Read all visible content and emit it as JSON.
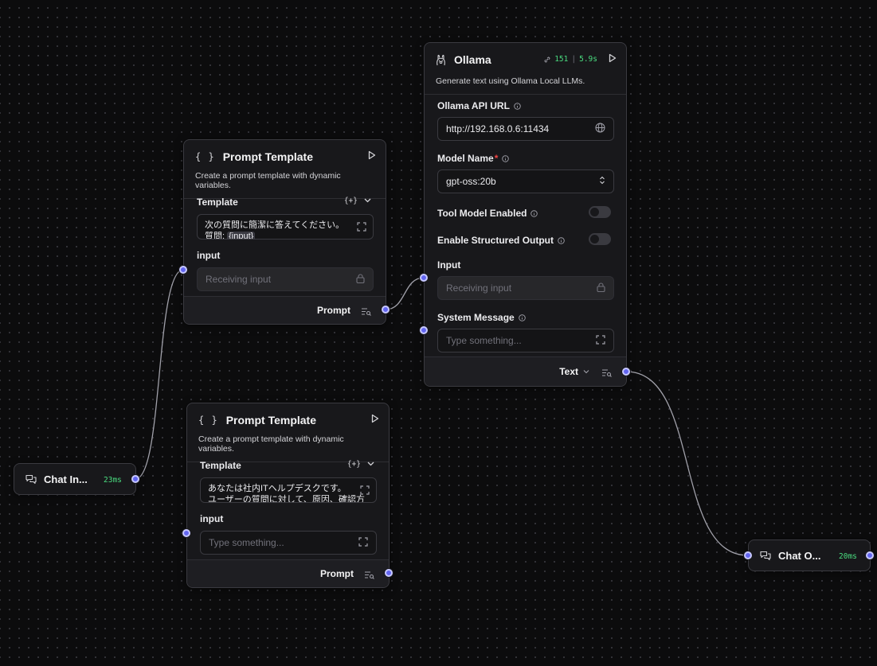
{
  "nodes": {
    "prompt1": {
      "title": "Prompt Template",
      "description": "Create a prompt template with dynamic variables.",
      "template_label": "Template",
      "template_actions": "{+}",
      "template_line1": "次の質問に簡潔に答えてください。",
      "template_line2_prefix": "質問: ",
      "template_line2_var": "{input}",
      "input_label": "input",
      "input_placeholder": "Receiving input",
      "output_label": "Prompt"
    },
    "prompt2": {
      "title": "Prompt Template",
      "description": "Create a prompt template with dynamic variables.",
      "template_label": "Template",
      "template_actions": "{+}",
      "template_line1": "あなたは社内ITヘルプデスクです。",
      "template_line2": "ユーザーの質問に対して、原因、確認方",
      "input_label": "input",
      "input_placeholder": "Type something...",
      "output_label": "Prompt"
    },
    "ollama": {
      "title": "Ollama",
      "tokens": "151",
      "latency": "5.9s",
      "description": "Generate text using Ollama Local LLMs.",
      "api_url_label": "Ollama API URL",
      "api_url_value": "http://192.168.0.6:11434",
      "model_name_label": "Model Name",
      "model_name_required": "*",
      "model_name_value": "gpt-oss:20b",
      "tool_model_label": "Tool Model Enabled",
      "tool_model_enabled": false,
      "structured_output_label": "Enable Structured Output",
      "structured_output_enabled": false,
      "input_label": "Input",
      "input_placeholder": "Receiving input",
      "system_message_label": "System Message",
      "system_message_placeholder": "Type something...",
      "output_label": "Text"
    },
    "chat_input": {
      "title": "Chat In...",
      "time": "23ms"
    },
    "chat_output": {
      "title": "Chat O...",
      "time": "20ms"
    }
  },
  "colors": {
    "canvas": "#0c0c0d",
    "node_bg": "#18181b",
    "handle": "#6366f1",
    "edge": "#a1a1aa",
    "success": "#4ade80",
    "required": "#ef4444"
  },
  "icons": [
    "braces-icon",
    "play-icon",
    "chevron-down-icon",
    "expand-icon",
    "lock-icon",
    "output-list-icon",
    "ollama-icon",
    "link-icon",
    "info-icon",
    "globe-icon",
    "selector-icon",
    "chat-icon"
  ]
}
